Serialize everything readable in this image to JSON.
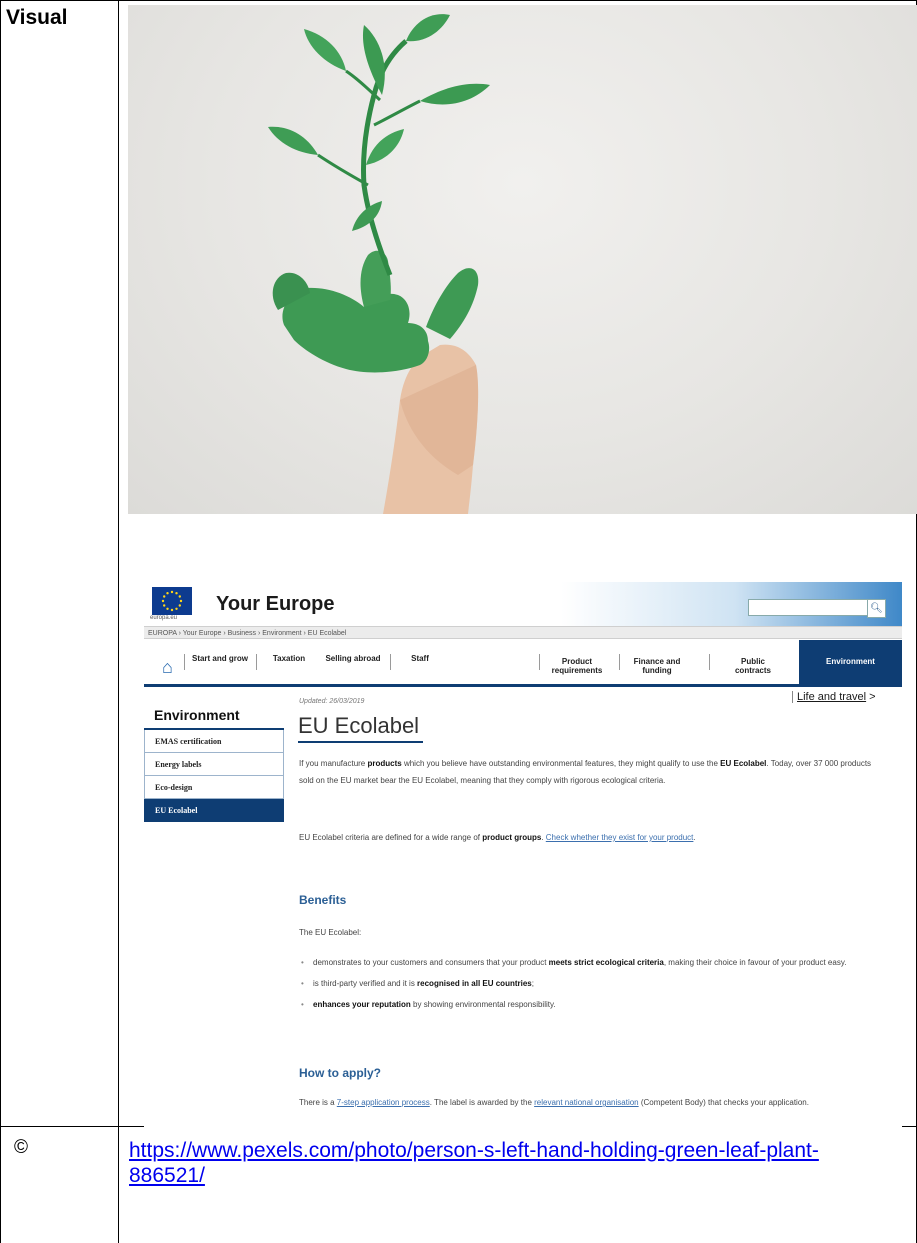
{
  "table": {
    "visual_label": "Visual",
    "copyright_label": "©",
    "source_link": "https://www.pexels.com/photo/person-s-left-hand-holding-green-leaf-plant-886521/"
  },
  "colors": {
    "leaf": "#3e9a54",
    "accent_navy": "#0e3d73",
    "link": "#0000ee"
  },
  "web": {
    "europa_text": "europa.eu",
    "site_title": "Your Europe",
    "search_icon": "search-icon",
    "breadcrumb": "EUROPA › Your Europe › Business › Environment › EU Ecolabel",
    "nav": {
      "home_icon": "home-icon",
      "items": [
        "Start and grow",
        "Taxation",
        "Selling abroad",
        "Staff",
        "Product requirements",
        "Finance and funding",
        "Public contracts"
      ],
      "active": "Environment"
    },
    "sidebar": {
      "title": "Environment",
      "items": [
        "EMAS certification",
        "Energy labels",
        "Eco-design",
        "EU Ecolabel"
      ],
      "active_index": 3
    },
    "updated": "Updated: 26/03/2019",
    "life_link": "Life and travel",
    "life_arrow": ">",
    "heading": "EU Ecolabel",
    "intro": {
      "t1": "If you manufacture ",
      "b1": "products",
      "t2": " which you believe have outstanding environmental features, they might qualify to use the ",
      "b2": "EU Ecolabel",
      "t3": ". Today, over 37 000 products sold on the EU market bear the EU Ecolabel, meaning that they comply with rigorous ecological criteria."
    },
    "criteria": {
      "t1": "EU Ecolabel criteria are defined for a wide range of ",
      "b1": "product groups",
      "t2": ". ",
      "link": "Check whether they exist for your product",
      "t3": "."
    },
    "benefits_heading": "Benefits",
    "benefits_intro": "The EU Ecolabel:",
    "benefits": [
      {
        "pre": "demonstrates to your customers and consumers that your product ",
        "bold": "meets strict ecological criteria",
        "post": ", making their choice in favour of your product easy."
      },
      {
        "pre": "is third-party verified and it is ",
        "bold": "recognised in all EU countries",
        "post": ";"
      },
      {
        "pre": "",
        "bold": "enhances your reputation",
        "post": " by showing environmental responsibility."
      }
    ],
    "apply_heading": "How to apply?",
    "apply": {
      "t1": "There is a ",
      "link1": "7-step application process",
      "t2": ". The label is awarded by the ",
      "link2": "relevant national organisation",
      "t3": " (Competent Body) that checks your application."
    }
  }
}
